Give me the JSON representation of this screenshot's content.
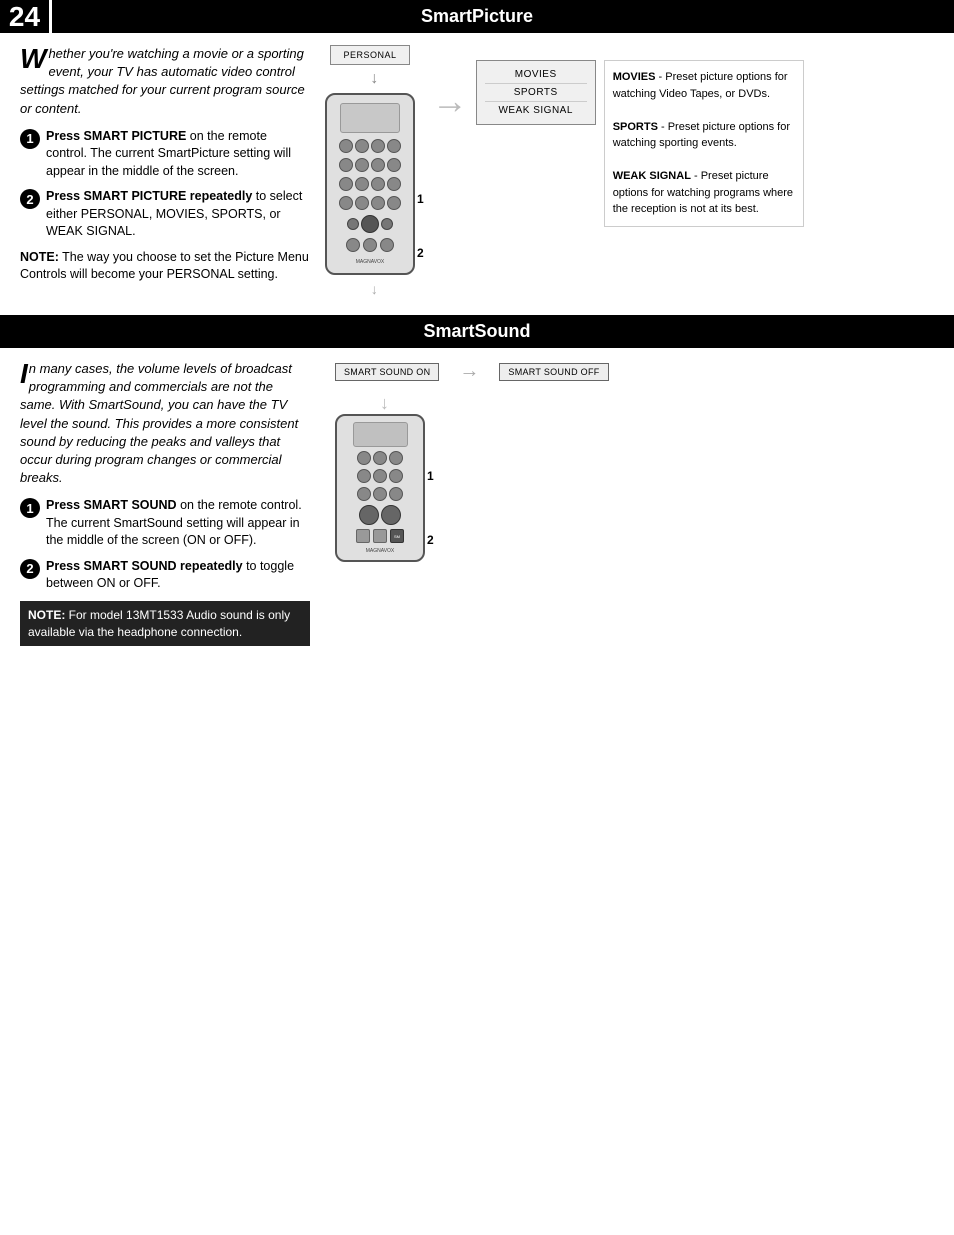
{
  "page": {
    "number": "24",
    "sections": {
      "smart_picture": {
        "title": "SmartPicture",
        "intro": "hether you're watching a movie or a sporting event, your TV has automatic video control settings matched for your current program source or content.",
        "drop_cap": "W",
        "step1": {
          "num": "1",
          "text_bold": "Press SMART PICTURE",
          "text_rest": " on the remote control. The current SmartPicture setting will appear in the middle of the screen."
        },
        "step2": {
          "num": "2",
          "text_bold": "Press SMART PICTURE repeatedly",
          "text_rest": " to select either PERSONAL, MOVIES, SPORTS, or WEAK SIGNAL."
        },
        "note": {
          "label": "NOTE:",
          "text": " The way you choose to set the Picture Menu Controls will become your PERSONAL setting."
        },
        "personal_label": "PERSONAL",
        "options": [
          "MOVIES",
          "SPORTS",
          "WEAK SIGNAL"
        ],
        "info_panel": {
          "movies_bold": "MOVIES",
          "movies_text": " - Preset picture options for watching Video Tapes, or DVDs.",
          "sports_bold": "SPORTS",
          "sports_text": " - Preset picture options for watching sporting events.",
          "weak_bold": "WEAK SIGNAL",
          "weak_text": " - Preset picture options for watching programs where the reception is not at its best."
        }
      },
      "smart_sound": {
        "title": "SmartSound",
        "intro": "n many cases, the volume levels of broadcast programming and commercials are not the same. With SmartSound, you can have the TV level the sound. This provides a more consistent sound by reducing the peaks and valleys that occur during program changes or commercial breaks.",
        "drop_cap": "I",
        "step1": {
          "num": "1",
          "text_bold": "Press SMART SOUND",
          "text_rest": " on the remote control. The current SmartSound setting will appear in the middle of the screen (ON or OFF)."
        },
        "step2": {
          "num": "2",
          "text_bold": "Press SMART SOUND repeatedly",
          "text_rest": " to toggle between ON or OFF."
        },
        "note": {
          "label": "NOTE",
          "colon": ":",
          "text": " For model 13MT1533 Audio sound is only available via the headphone connection."
        },
        "btn_on": "SMART SOUND ON",
        "btn_off": "SMART SOUND OFF"
      }
    }
  }
}
